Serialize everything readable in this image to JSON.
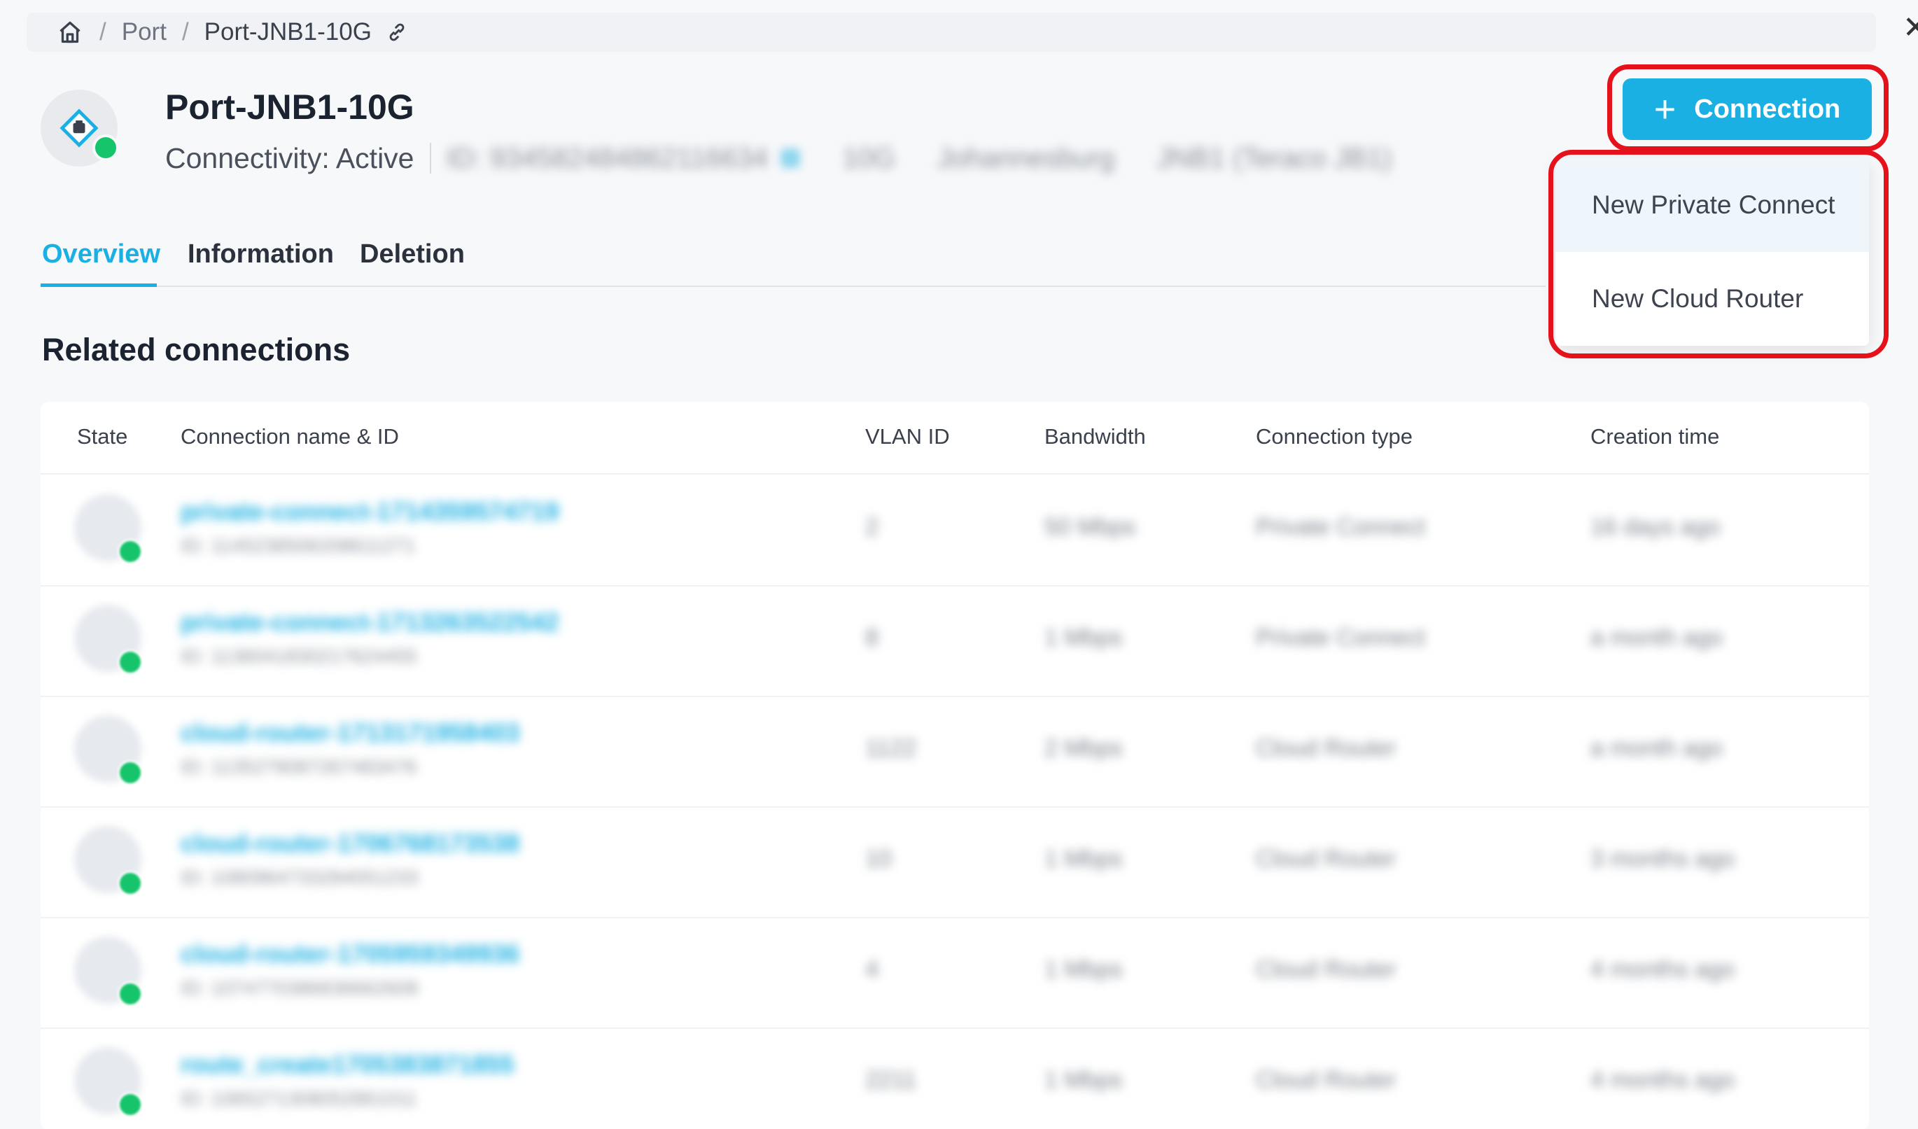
{
  "breadcrumb": {
    "items": [
      "Port",
      "Port-JNB1-10G"
    ],
    "home_icon": "home-icon",
    "link_icon": "link-icon"
  },
  "header": {
    "title": "Port-JNB1-10G",
    "connectivity": "Connectivity: Active",
    "meta": {
      "id": "ID: 934582484862116634",
      "speed": "10G",
      "city": "Johannesburg",
      "site": "JNB1 (Teraco JB1)"
    },
    "status_color": "#16c46b"
  },
  "actions": {
    "connection_button": "Connection",
    "accent": "#1bb0e3",
    "menu": [
      "New Private Connect",
      "New Cloud Router"
    ]
  },
  "tabs": [
    {
      "label": "Overview",
      "active": true
    },
    {
      "label": "Information",
      "active": false
    },
    {
      "label": "Deletion",
      "active": false
    }
  ],
  "related": {
    "title": "Related connections",
    "columns": [
      "State",
      "Connection name & ID",
      "VLAN ID",
      "Bandwidth",
      "Connection type",
      "Creation time"
    ],
    "rows": [
      {
        "name": "private-connect-1714359574719",
        "id": "ID: 1145238506208611271",
        "vlan": "2",
        "bandwidth": "50 Mbps",
        "type": "Private Connect",
        "created": "16 days ago"
      },
      {
        "name": "private-connect-1713263522542",
        "id": "ID: 1136041830217624455",
        "vlan": "8",
        "bandwidth": "1 Mbps",
        "type": "Private Connect",
        "created": "a month ago"
      },
      {
        "name": "cloud-router-1713171958403",
        "id": "ID: 1135279087267483476",
        "vlan": "1122",
        "bandwidth": "2 Mbps",
        "type": "Cloud Router",
        "created": "a month ago"
      },
      {
        "name": "cloud-router-1706768173538",
        "id": "ID: 1080964733284051233",
        "vlan": "10",
        "bandwidth": "1 Mbps",
        "type": "Cloud Router",
        "created": "3 months ago"
      },
      {
        "name": "cloud-router-1705959349936",
        "id": "ID: 1074770386836662608",
        "vlan": "4",
        "bandwidth": "1 Mbps",
        "type": "Cloud Router",
        "created": "4 months ago"
      },
      {
        "name": "route_create1705383871855",
        "id": "ID: 1065271308052861011",
        "vlan": "2211",
        "bandwidth": "1 Mbps",
        "type": "Cloud Router",
        "created": "4 months ago"
      }
    ]
  }
}
